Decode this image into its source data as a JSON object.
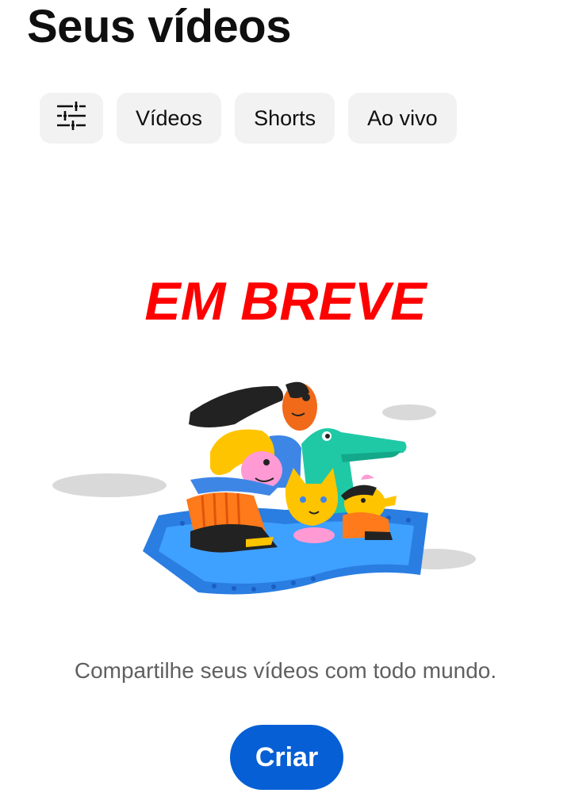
{
  "header": {
    "title": "Seus vídeos"
  },
  "filters": {
    "filter_icon": "sliders-icon",
    "chips": [
      {
        "label": "Vídeos"
      },
      {
        "label": "Shorts"
      },
      {
        "label": "Ao vivo"
      }
    ]
  },
  "banner": {
    "text": "EM BREVE",
    "color": "#ff0000"
  },
  "empty_state": {
    "illustration": "people-crocodile-cat-dog-riding-film-strip-illustration",
    "message": "Compartilhe seus vídeos com todo mundo.",
    "create_label": "Criar",
    "button_color": "#065fd4"
  }
}
